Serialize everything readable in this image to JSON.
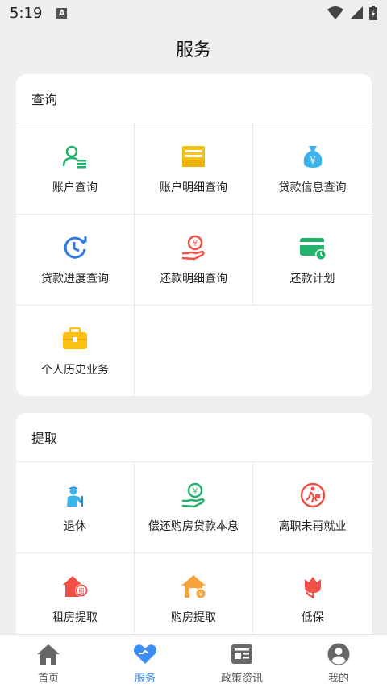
{
  "status_bar": {
    "time": "5:19",
    "notif_letter": "A"
  },
  "page_title": "服务",
  "sections": [
    {
      "title": "查询",
      "items": [
        {
          "label": "账户查询",
          "icon": "account-query-icon"
        },
        {
          "label": "账户明细查询",
          "icon": "account-detail-icon"
        },
        {
          "label": "贷款信息查询",
          "icon": "loan-info-icon"
        },
        {
          "label": "贷款进度查询",
          "icon": "loan-progress-icon"
        },
        {
          "label": "还款明细查询",
          "icon": "repay-detail-icon"
        },
        {
          "label": "还款计划",
          "icon": "repay-plan-icon"
        },
        {
          "label": "个人历史业务",
          "icon": "history-business-icon"
        }
      ]
    },
    {
      "title": "提取",
      "items": [
        {
          "label": "退休",
          "icon": "retire-icon"
        },
        {
          "label": "偿还购房贷款本息",
          "icon": "repay-mortgage-icon"
        },
        {
          "label": "离职未再就业",
          "icon": "resign-icon"
        },
        {
          "label": "租房提取",
          "icon": "rent-icon"
        },
        {
          "label": "购房提取",
          "icon": "buy-house-icon"
        },
        {
          "label": "低保",
          "icon": "subsistence-icon"
        }
      ]
    }
  ],
  "bottom_nav": [
    {
      "label": "首页",
      "icon": "home-icon",
      "active": false
    },
    {
      "label": "服务",
      "icon": "heart-icon",
      "active": true
    },
    {
      "label": "政策资讯",
      "icon": "news-icon",
      "active": false
    },
    {
      "label": "我的",
      "icon": "profile-icon",
      "active": false
    }
  ],
  "colors": {
    "accent": "#3a8ef6",
    "green": "#21b36a",
    "yellow": "#f9c212",
    "red": "#f24f46",
    "blue": "#3a8ef6"
  }
}
